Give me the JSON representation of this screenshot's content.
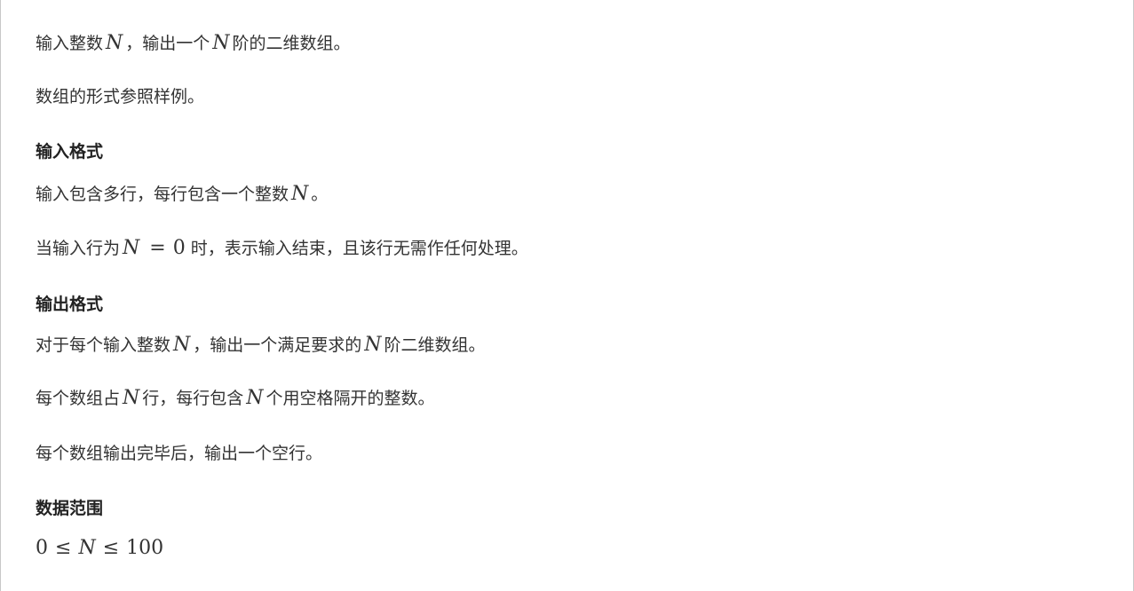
{
  "problem": {
    "intro_1": {
      "text_a": "输入整数",
      "var_a": "N",
      "text_b": "，输出一个",
      "var_b": "N",
      "text_c": "阶的二维数组。"
    },
    "intro_2": "数组的形式参照样例。",
    "input_heading": "输入格式",
    "input_1": {
      "text_a": "输入包含多行，每行包含一个整数",
      "var_a": "N",
      "text_b": "。"
    },
    "input_2": {
      "text_a": "当输入行为",
      "var_a": "N",
      "op": "=",
      "num": "0",
      "text_b": "时，表示输入结束，且该行无需作任何处理。"
    },
    "output_heading": "输出格式",
    "output_1": {
      "text_a": "对于每个输入整数",
      "var_a": "N",
      "text_b": "，输出一个满足要求的",
      "var_b": "N",
      "text_c": "阶二维数组。"
    },
    "output_2": {
      "text_a": "每个数组占",
      "var_a": "N",
      "text_b": "行，每行包含",
      "var_b": "N",
      "text_c": "个用空格隔开的整数。"
    },
    "output_3": "每个数组输出完毕后，输出一个空行。",
    "range_heading": "数据范围",
    "range": {
      "low": "0",
      "op1": "≤",
      "var": "N",
      "op2": "≤",
      "high": "100"
    }
  }
}
